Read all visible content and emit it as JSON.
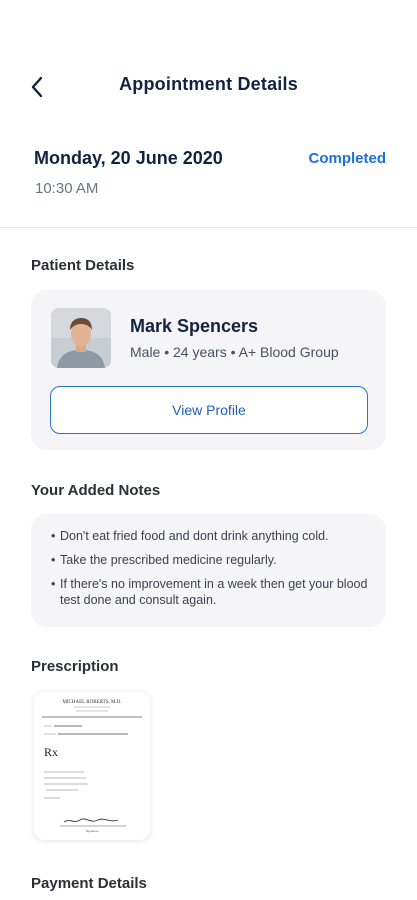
{
  "header": {
    "title": "Appointment Details",
    "back_icon": "chevron-left-icon"
  },
  "appointment": {
    "date": "Monday, 20 June 2020",
    "time": "10:30 AM",
    "status": "Completed",
    "status_color": "#1e6fdc"
  },
  "patient_section": {
    "title": "Patient Details",
    "name": "Mark Spencers",
    "meta": "Male • 24 years • A+ Blood Group",
    "view_profile_label": "View Profile"
  },
  "notes_section": {
    "title": "Your Added Notes",
    "notes": [
      "Don't eat fried food and dont drink anything cold.",
      "Take the prescribed medicine regularly.",
      "If there's no improvement in a week then get your blood test done and  consult again."
    ]
  },
  "prescription_section": {
    "title": "Prescription",
    "doctor": "MICHAEL ROBERTS, M.D.",
    "rx_symbol": "Rx",
    "signature_label": "Signature"
  },
  "payment_section": {
    "title": "Payment Details"
  },
  "colors": {
    "accent": "#1e6fdc",
    "card_bg": "#f5f5f7",
    "title": "#13233f"
  }
}
